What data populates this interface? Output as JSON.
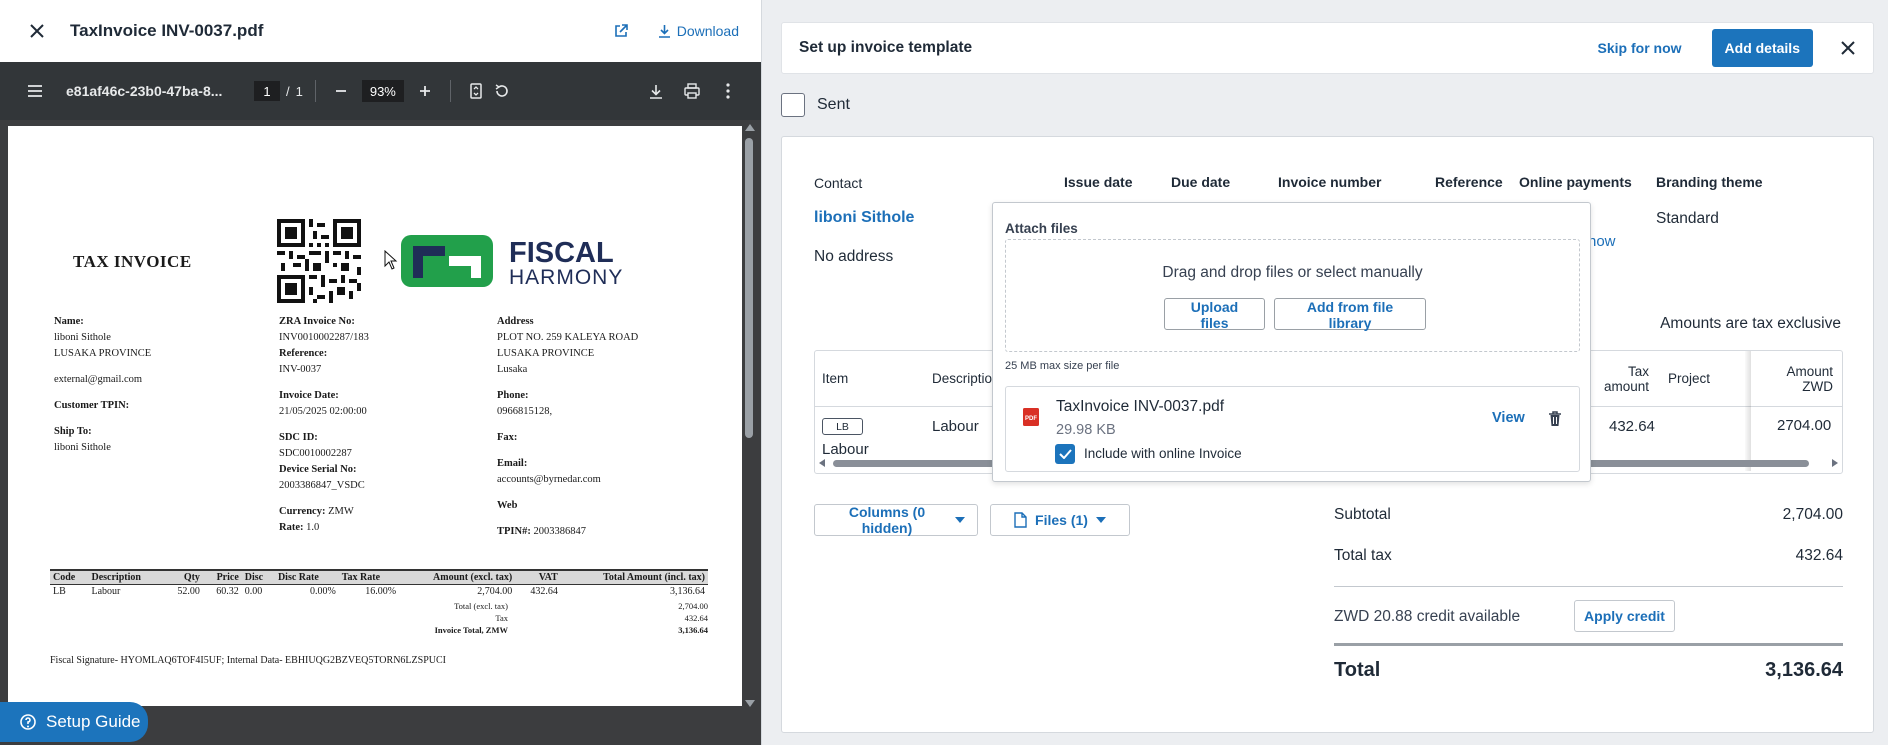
{
  "viewer": {
    "title": "TaxInvoice INV-0037.pdf",
    "download_label": "Download",
    "pdf_filename": "e81af46c-23b0-47ba-8...",
    "page_current": "1",
    "page_sep": "/",
    "page_total": "1",
    "zoom": "93%"
  },
  "pdf": {
    "heading": "TAX INVOICE",
    "logo_line1": "FISCAL",
    "logo_line2": "HARMONY",
    "name_label": "Name:",
    "name_value": "liboni Sithole",
    "province": "LUSAKA PROVINCE",
    "email_ext": "external@gmail.com",
    "customer_tpin_label": "Customer TPIN:",
    "ship_to_label": "Ship To:",
    "ship_to_value": "liboni Sithole",
    "zra_label": "ZRA Invoice No:",
    "zra_value": "INV0010002287/183",
    "reference_label": "Reference:",
    "reference_value": "INV-0037",
    "invoice_date_label": "Invoice Date:",
    "invoice_date_value": "21/05/2025 02:00:00",
    "sdc_label": "SDC ID:",
    "sdc_value": "SDC0010002287",
    "device_label": "Device Serial No:",
    "device_value": "2003386847_VSDC",
    "currency_label": "Currency:",
    "currency_value": "ZMW",
    "rate_label": "Rate:",
    "rate_value": "1.0",
    "address_label": "Address",
    "address_1": "PLOT NO. 259 KALEYA ROAD",
    "address_2": "LUSAKA PROVINCE",
    "address_3": "Lusaka",
    "phone_label": "Phone:",
    "phone_value": "0966815128,",
    "fax_label": "Fax:",
    "email_label": "Email:",
    "email_value": "accounts@byrnedar.com",
    "web_label": "Web",
    "tpin_label": "TPIN#:",
    "tpin_value": "2003386847",
    "table_headers": [
      "Code",
      "Description",
      "Qty",
      "Price",
      "Disc",
      "Disc Rate",
      "Tax Rate",
      "Amount (excl. tax)",
      "VAT",
      "Total Amount (incl. tax)"
    ],
    "table_row": [
      "LB",
      "Labour",
      "52.00",
      "60.32",
      "0.00",
      "0.00%",
      "16.00%",
      "2,704.00",
      "432.64",
      "3,136.64"
    ],
    "total_excl_label": "Total (excl. tax)",
    "total_excl_value": "2,704.00",
    "tax_label": "Tax",
    "tax_value": "432.64",
    "invoice_total_label": "Invoice Total, ZMW",
    "invoice_total_value": "3,136.64",
    "fiscal_signature": "Fiscal Signature- HYOMLAQ6TOF4I5UF; Internal Data- EBHIUQG2BZVEQ5TORN6LZSPUCI"
  },
  "setup_guide_label": "Setup Guide",
  "setup_banner": {
    "title": "Set up invoice template",
    "skip_label": "Skip for now",
    "add_details_label": "Add details"
  },
  "status": {
    "sent_label": "Sent"
  },
  "invoice": {
    "labels": {
      "contact": "Contact",
      "issue_date": "Issue date",
      "due_date": "Due date",
      "invoice_number": "Invoice number",
      "reference": "Reference",
      "online_payments": "Online payments",
      "branding_theme": "Branding theme"
    },
    "contact_name": "liboni Sithole",
    "no_address": "No address",
    "branding_value": "Standard",
    "online_payments_link_fragment": "now",
    "amounts_are": "Amounts are tax exclusive",
    "line_headers": {
      "item": "Item",
      "description": "Description",
      "tax_amount_1": "Tax",
      "tax_amount_2": "amount",
      "project": "Project",
      "amount_1": "Amount",
      "amount_2": "ZWD"
    },
    "line_item": {
      "code": "LB",
      "item_name": "Labour",
      "description": "Labour",
      "tax_amount": "432.64",
      "amount": "2704.00"
    },
    "columns_btn": "Columns (0 hidden)",
    "files_btn": "Files (1)",
    "subtotal_label": "Subtotal",
    "subtotal_value": "2,704.00",
    "total_tax_label": "Total tax",
    "total_tax_value": "432.64",
    "credit_text": "ZWD 20.88 credit available",
    "apply_credit_label": "Apply credit",
    "total_label": "Total",
    "total_value": "3,136.64"
  },
  "attach": {
    "title": "Attach files",
    "drop_text": "Drag and drop files or select manually",
    "upload_label": "Upload files",
    "library_label": "Add from file library",
    "max_size": "25 MB max size per file",
    "file_name": "TaxInvoice INV-0037.pdf",
    "file_size": "29.98 KB",
    "include_label": "Include with online Invoice",
    "view_label": "View",
    "file_icon_text": "PDF"
  },
  "colors": {
    "accent": "#1c74bc",
    "link": "#1c6fb8",
    "pdf_toolbar": "#323639",
    "logo_green": "#22a04b",
    "logo_navy": "#1f2d57"
  },
  "icons": {
    "close": "close-icon",
    "external": "external-link-icon",
    "download": "download-icon",
    "menu": "menu-icon",
    "zoom_out": "minus-icon",
    "zoom_in": "plus-icon",
    "fit": "fit-page-icon",
    "rotate": "rotate-icon",
    "print": "print-icon",
    "more": "more-vertical-icon",
    "help": "help-icon",
    "trash": "trash-icon",
    "file": "file-icon",
    "check": "check-icon"
  }
}
